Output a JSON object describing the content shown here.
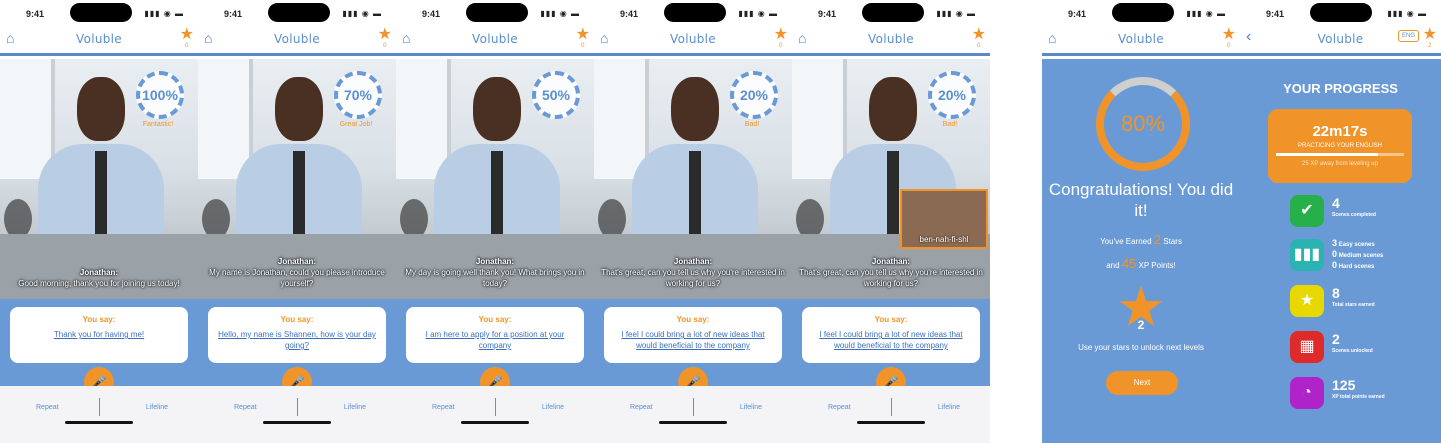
{
  "status_time": "9:41",
  "status_icons": "▮▮▮ ◉ ▬",
  "brand": "Voluble",
  "stars": "0",
  "stars_progress": "2",
  "say_heading": "You say:",
  "repeat": "Repeat",
  "lifeline": "Lifeline",
  "screens": [
    {
      "score": "100%",
      "score_label": "Fantastic!",
      "speaker": "Jonathan:",
      "line": "Good morning, thank you for joining us today!",
      "say": "Thank you for having me!"
    },
    {
      "score": "70%",
      "score_label": "Great Job!",
      "speaker": "Jonathan:",
      "line": "My name is Jonathan, could you please introduce yourself?",
      "say": "Hello, my name is Shannen, how is your day going?"
    },
    {
      "score": "50%",
      "score_label": "",
      "speaker": "Jonathan:",
      "line": "My day is going well thank you! What brings you in today?",
      "say": "I am here to apply for a position at your company"
    },
    {
      "score": "20%",
      "score_label": "Bad!",
      "speaker": "Jonathan:",
      "line": "That's great, can you tell us why you're interested in working for us?",
      "say": "I feel I could bring a lot of new ideas that would beneficial to the company"
    },
    {
      "score": "20%",
      "score_label": "Bad!",
      "speaker": "Jonathan:",
      "line": "That's great, can you tell us why you're interested in working for us?",
      "say": "I feel I could bring a lot of new ideas that would beneficial to the company",
      "pip_label": "ben-nah-fi-shl"
    }
  ],
  "congrats": {
    "score": "80%",
    "title": "Congratulations! You did it!",
    "earned_pre": "You've Earned",
    "earned_stars": "2",
    "earned_post": "Stars",
    "and": "and",
    "xp": "45",
    "xp_post": "XP Points!",
    "star_num": "2",
    "unlock": "Use your stars to unlock next levels",
    "next": "Next"
  },
  "progress": {
    "back": "‹",
    "lang": "ENG",
    "title": "YOUR PROGRESS",
    "time": "22m17s",
    "practicing": "PRACTICING YOUR ENGLISH",
    "xp_away": "25 XP away from leveling up",
    "level_fill": 0.8,
    "stats": [
      {
        "value": "4",
        "label": "Scenes completed",
        "icon": "check-icon",
        "color": "#27b04a"
      },
      {
        "value": "3",
        "label": "Easy scenes",
        "value2": "0",
        "label2": "Medium scenes",
        "value3": "0",
        "label3": "Hard scenes",
        "icon": "bars-icon",
        "color": "#2bb3b1"
      },
      {
        "value": "8",
        "label": "Total stars earned",
        "icon": "star-icon",
        "color": "#e6d800"
      },
      {
        "value": "2",
        "label": "Scenes unlocked",
        "icon": "film-icon",
        "color": "#e02a2a"
      },
      {
        "value": "125",
        "label": "XP total points earned",
        "icon": "pie-icon",
        "color": "#b023c9"
      }
    ]
  }
}
